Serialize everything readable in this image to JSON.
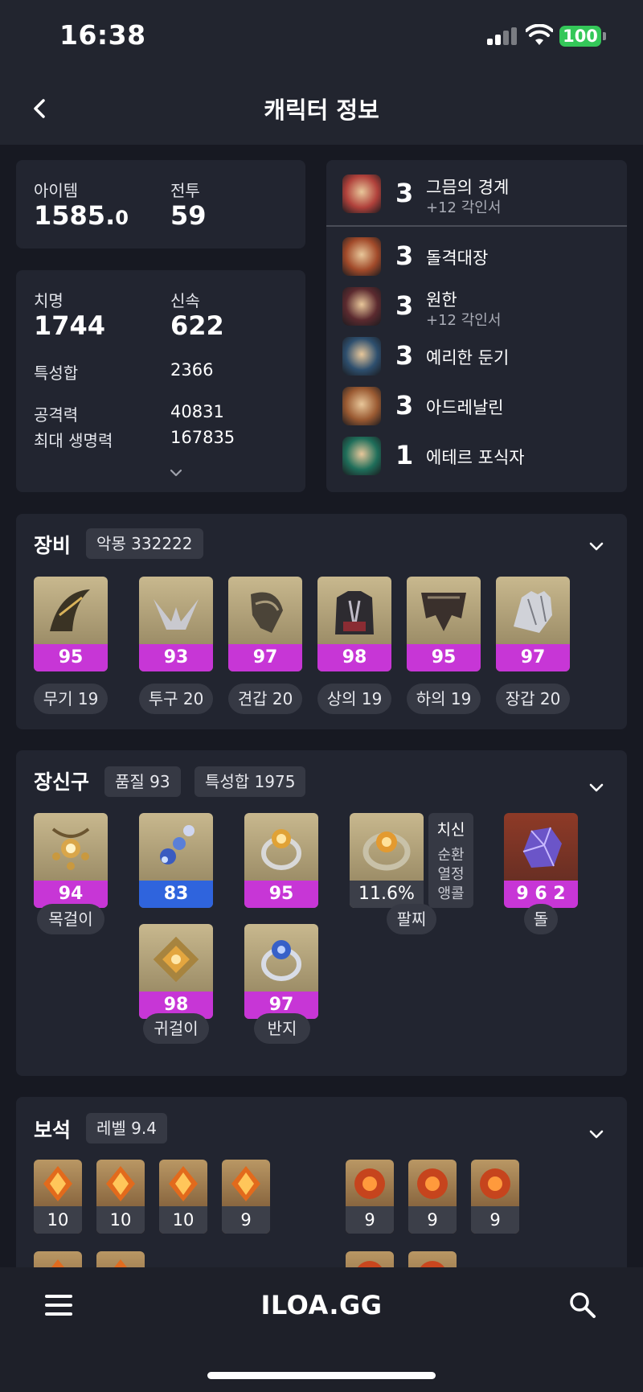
{
  "status": {
    "time": "16:38",
    "battery": "100"
  },
  "header": {
    "title": "캐릭터 정보"
  },
  "summary": {
    "item_label": "아이템",
    "item_level_int": "1585.",
    "item_level_dec": "0",
    "battle_label": "전투",
    "battle_level": "59"
  },
  "stats": {
    "crit_label": "치명",
    "crit": "1744",
    "swift_label": "신속",
    "swift": "622",
    "total_label": "특성합",
    "total": "2366",
    "atk_label": "공격력",
    "atk": "40831",
    "hp_label": "최대 생명력",
    "hp": "167835"
  },
  "engravings": [
    {
      "level": "3",
      "name": "그믐의 경계",
      "sub": "+12 각인서",
      "color": "#b0413b"
    },
    {
      "level": "3",
      "name": "돌격대장",
      "sub": "",
      "color": "#a14a2a"
    },
    {
      "level": "3",
      "name": "원한",
      "sub": "+12 각인서",
      "color": "#5b2a2f"
    },
    {
      "level": "3",
      "name": "예리한 둔기",
      "sub": "",
      "color": "#2e4f6e"
    },
    {
      "level": "3",
      "name": "아드레날린",
      "sub": "",
      "color": "#9a5a32"
    },
    {
      "level": "1",
      "name": "에테르 포식자",
      "sub": "",
      "color": "#1f6e5a"
    }
  ],
  "equipment": {
    "title": "장비",
    "set_tag": "악몽 332222",
    "items": [
      {
        "quality": "95",
        "label": "무기 19",
        "icon": "weapon-icon"
      },
      {
        "quality": "93",
        "label": "투구 20",
        "icon": "helmet-icon"
      },
      {
        "quality": "97",
        "label": "견갑 20",
        "icon": "shoulder-icon"
      },
      {
        "quality": "98",
        "label": "상의 19",
        "icon": "chest-icon"
      },
      {
        "quality": "95",
        "label": "하의 19",
        "icon": "pants-icon"
      },
      {
        "quality": "97",
        "label": "장갑 20",
        "icon": "gloves-icon"
      }
    ]
  },
  "accessories": {
    "title": "장신구",
    "quality_tag": "품질 93",
    "stat_tag": "특성합 1975",
    "necklace": {
      "quality": "94",
      "label": "목걸이"
    },
    "earring1": {
      "quality": "83"
    },
    "earring2": {
      "quality": "98",
      "label": "귀걸이"
    },
    "ring1": {
      "quality": "95"
    },
    "ring2": {
      "quality": "97",
      "label": "반지"
    },
    "bracelet": {
      "value": "11.6%",
      "label": "팔찌",
      "effects": [
        "치신",
        "순환",
        "열정",
        "앵콜"
      ]
    },
    "stone": {
      "value": "9 6 2",
      "label": "돌"
    }
  },
  "gems": {
    "title": "보석",
    "level_tag": "레벨 9.4",
    "left": [
      "10",
      "10",
      "10",
      "9"
    ],
    "right": [
      "9",
      "9",
      "9"
    ]
  },
  "bottom": {
    "logo": "ILOA.GG"
  }
}
